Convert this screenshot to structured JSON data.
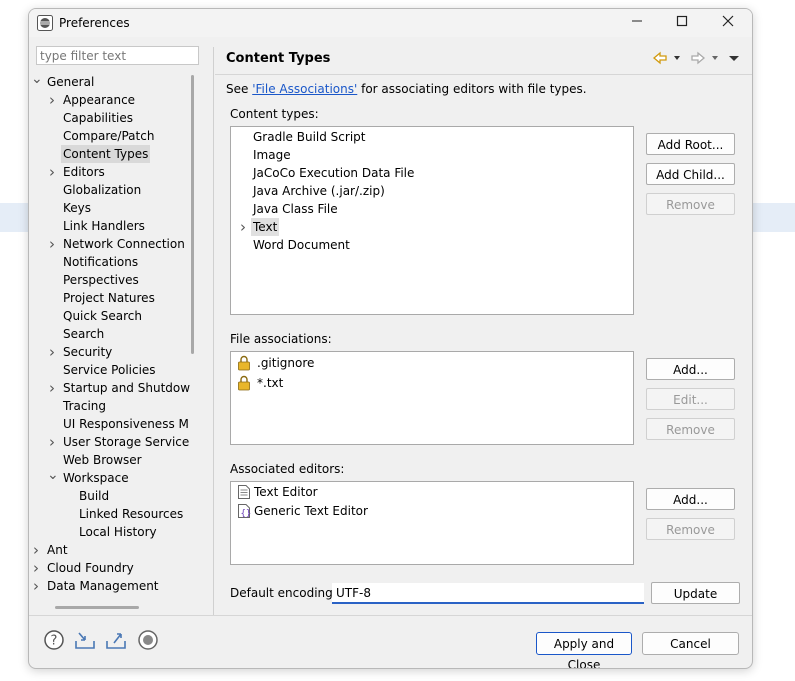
{
  "window": {
    "title": "Preferences",
    "controls": [
      "minimize",
      "maximize",
      "close"
    ]
  },
  "filter": {
    "placeholder": "type filter text"
  },
  "tree": [
    {
      "label": "General",
      "level": 0,
      "toggle": "expanded"
    },
    {
      "label": "Appearance",
      "level": 1,
      "toggle": "collapsed"
    },
    {
      "label": "Capabilities",
      "level": 1,
      "toggle": "none"
    },
    {
      "label": "Compare/Patch",
      "level": 1,
      "toggle": "none"
    },
    {
      "label": "Content Types",
      "level": 1,
      "toggle": "none",
      "selected": true
    },
    {
      "label": "Editors",
      "level": 1,
      "toggle": "collapsed"
    },
    {
      "label": "Globalization",
      "level": 1,
      "toggle": "none"
    },
    {
      "label": "Keys",
      "level": 1,
      "toggle": "none"
    },
    {
      "label": "Link Handlers",
      "level": 1,
      "toggle": "none"
    },
    {
      "label": "Network Connection",
      "level": 1,
      "toggle": "collapsed"
    },
    {
      "label": "Notifications",
      "level": 1,
      "toggle": "none"
    },
    {
      "label": "Perspectives",
      "level": 1,
      "toggle": "none"
    },
    {
      "label": "Project Natures",
      "level": 1,
      "toggle": "none"
    },
    {
      "label": "Quick Search",
      "level": 1,
      "toggle": "none"
    },
    {
      "label": "Search",
      "level": 1,
      "toggle": "none"
    },
    {
      "label": "Security",
      "level": 1,
      "toggle": "collapsed"
    },
    {
      "label": "Service Policies",
      "level": 1,
      "toggle": "none"
    },
    {
      "label": "Startup and Shutdow",
      "level": 1,
      "toggle": "collapsed"
    },
    {
      "label": "Tracing",
      "level": 1,
      "toggle": "none"
    },
    {
      "label": "UI Responsiveness M",
      "level": 1,
      "toggle": "none"
    },
    {
      "label": "User Storage Service",
      "level": 1,
      "toggle": "collapsed"
    },
    {
      "label": "Web Browser",
      "level": 1,
      "toggle": "none"
    },
    {
      "label": "Workspace",
      "level": 1,
      "toggle": "expanded"
    },
    {
      "label": "Build",
      "level": 2,
      "toggle": "none"
    },
    {
      "label": "Linked Resources",
      "level": 2,
      "toggle": "none"
    },
    {
      "label": "Local History",
      "level": 2,
      "toggle": "none"
    },
    {
      "label": "Ant",
      "level": 0,
      "toggle": "collapsed"
    },
    {
      "label": "Cloud Foundry",
      "level": 0,
      "toggle": "collapsed"
    },
    {
      "label": "Data Management",
      "level": 0,
      "toggle": "collapsed"
    }
  ],
  "main": {
    "header": "Content Types",
    "nav_icons": [
      "back-arrow-icon",
      "back-dropdown-icon",
      "forward-arrow-icon",
      "forward-dropdown-icon",
      "view-menu-icon"
    ],
    "description": {
      "prefix": "See ",
      "link": "'File Associations'",
      "suffix": " for associating editors with file types."
    },
    "content_types": {
      "label": "Content types:",
      "items": [
        {
          "label": "Gradle Build Script",
          "toggle": "none"
        },
        {
          "label": "Image",
          "toggle": "none"
        },
        {
          "label": "JaCoCo Execution Data File",
          "toggle": "none"
        },
        {
          "label": "Java Archive (.jar/.zip)",
          "toggle": "none"
        },
        {
          "label": "Java Class File",
          "toggle": "none"
        },
        {
          "label": "Text",
          "toggle": "collapsed",
          "selected": true
        },
        {
          "label": "Word Document",
          "toggle": "none"
        }
      ],
      "buttons": {
        "add_root": "Add Root...",
        "add_child": "Add Child...",
        "remove": "Remove"
      }
    },
    "file_associations": {
      "label": "File associations:",
      "items": [
        {
          "label": ".gitignore",
          "icon": "lock-icon"
        },
        {
          "label": "*.txt",
          "icon": "lock-icon"
        }
      ],
      "buttons": {
        "add": "Add...",
        "edit": "Edit...",
        "remove": "Remove"
      }
    },
    "associated_editors": {
      "label": "Associated editors:",
      "items": [
        {
          "label": "Text Editor",
          "icon": "text-editor-icon"
        },
        {
          "label": "Generic Text Editor",
          "icon": "generic-editor-icon"
        }
      ],
      "buttons": {
        "add": "Add...",
        "remove": "Remove"
      }
    },
    "encoding": {
      "label": "Default encoding:",
      "value": "UTF-8",
      "update": "Update"
    }
  },
  "footer": {
    "icons": [
      "help-icon",
      "import-icon",
      "export-icon",
      "record-icon"
    ],
    "apply_and_close": "Apply and Close",
    "cancel": "Cancel"
  },
  "colors": {
    "accent": "#1a57c9",
    "nav_arrow": "#d19a0e",
    "selection": "#d9d9d9"
  }
}
